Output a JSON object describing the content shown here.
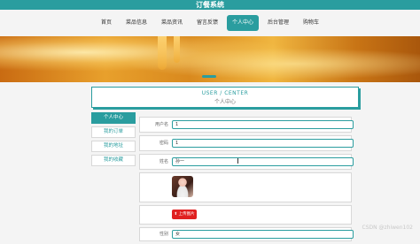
{
  "app_title": "订餐系统",
  "nav": {
    "items": [
      {
        "label": "首页",
        "active": false
      },
      {
        "label": "菜品信息",
        "active": false
      },
      {
        "label": "菜品资讯",
        "active": false
      },
      {
        "label": "留言反馈",
        "active": false
      },
      {
        "label": "个人中心",
        "active": true
      },
      {
        "label": "后台管理",
        "active": false
      },
      {
        "label": "购物车",
        "active": false
      }
    ]
  },
  "section": {
    "title_en": "USER / CENTER",
    "title_cn": "个人中心"
  },
  "sidebar": {
    "items": [
      {
        "label": "个人中心",
        "active": true
      },
      {
        "label": "我的订单",
        "active": false
      },
      {
        "label": "我的地址",
        "active": false
      },
      {
        "label": "我的收藏",
        "active": false
      }
    ]
  },
  "form": {
    "username_label": "用户名",
    "username_value": "1",
    "password_label": "密码",
    "password_value": "1",
    "name_label": "姓名",
    "name_value": "孙一",
    "upload_label": "上传图片",
    "gender_label": "性别",
    "gender_value": "女"
  },
  "watermark": "CSDN @zhiwen102",
  "colors": {
    "accent": "#2a9d9f",
    "upload": "#e02020"
  }
}
